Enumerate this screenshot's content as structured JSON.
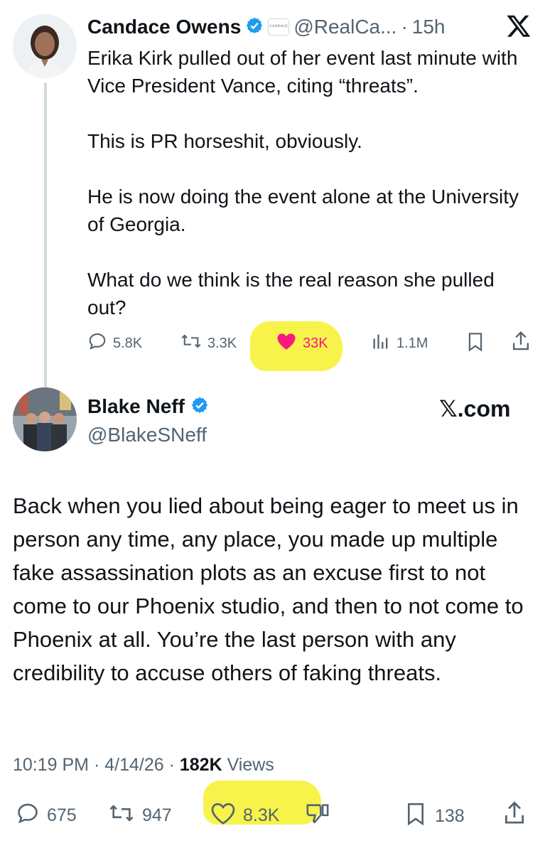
{
  "tweet1": {
    "author_name": "Candace Owens",
    "affiliate_badge_text": "CANDACE",
    "handle": "@RealCa...",
    "separator": "·",
    "time": "15h",
    "body": "Erika Kirk pulled out of her event last minute with Vice President Vance, citing “threats”.\n\nThis is PR horseshit, obviously.\n\nHe is now doing the event alone at the University of Georgia.\n\nWhat do we think is the real reason she pulled out?",
    "actions": {
      "replies": "5.8K",
      "reposts": "3.3K",
      "likes": "33K",
      "views": "1.1M"
    }
  },
  "tweet2": {
    "author_name": "Blake Neff",
    "handle": "@BlakeSNeff",
    "brand": "𝕏.com",
    "body": "Back when you lied about being eager to meet us in person any time, any place, you made up multiple fake assassination plots as an excuse first to not come to our Phoenix studio, and then to not come to Phoenix at all. You’re the last person with any credibility to accuse others of faking threats.",
    "timestamp": "10:19 PM · 4/14/26 · ",
    "views_count": "182K",
    "views_label": " Views",
    "actions": {
      "replies": "675",
      "reposts": "947",
      "likes": "8.3K",
      "bookmarks": "138"
    }
  },
  "colors": {
    "verified_blue": "#1d9bf0",
    "like_red": "#f91880",
    "highlight_yellow": "#f6f12a",
    "text_secondary": "#536471"
  },
  "icons": [
    "verified-badge-icon",
    "x-logo-icon",
    "reply-icon",
    "repost-icon",
    "heart-icon",
    "views-icon",
    "bookmark-icon",
    "share-icon",
    "dislike-icon"
  ]
}
